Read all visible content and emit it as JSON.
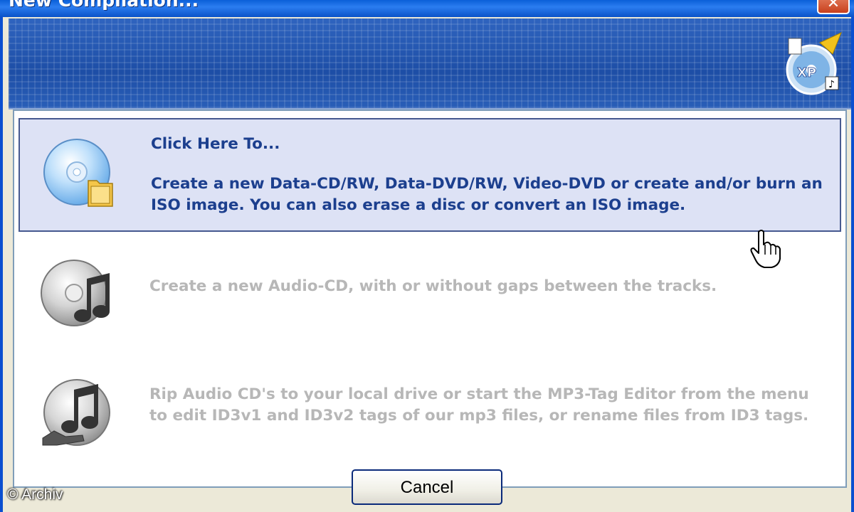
{
  "window": {
    "title": "New Compilation...",
    "close_icon": "close-icon"
  },
  "banner": {
    "logo_text": "XP",
    "logo_icon": "burner-disc-logo-icon"
  },
  "options": [
    {
      "icon": "data-disc-icon",
      "heading": "Click Here To...",
      "text": "Create a new Data-CD/RW, Data-DVD/RW, Video-DVD or create and/or burn an ISO image. You can also erase a disc or convert an ISO image.",
      "state": "selected"
    },
    {
      "icon": "audio-cd-icon",
      "text": "Create a new Audio-CD, with or without gaps between the tracks.",
      "state": "disabled"
    },
    {
      "icon": "rip-audio-icon",
      "text": "Rip Audio CD's to your local drive or start the MP3-Tag Editor from the menu to edit ID3v1 and ID3v2 tags of our mp3 files, or rename files from ID3 tags.",
      "state": "disabled"
    }
  ],
  "cancel_label": "Cancel",
  "watermark": "© Archiv",
  "colors": {
    "selection_bg": "#dde2f5",
    "selection_text": "#1c3f8e",
    "disabled_text": "#b7b7b7",
    "banner": "#1c4fa8"
  }
}
